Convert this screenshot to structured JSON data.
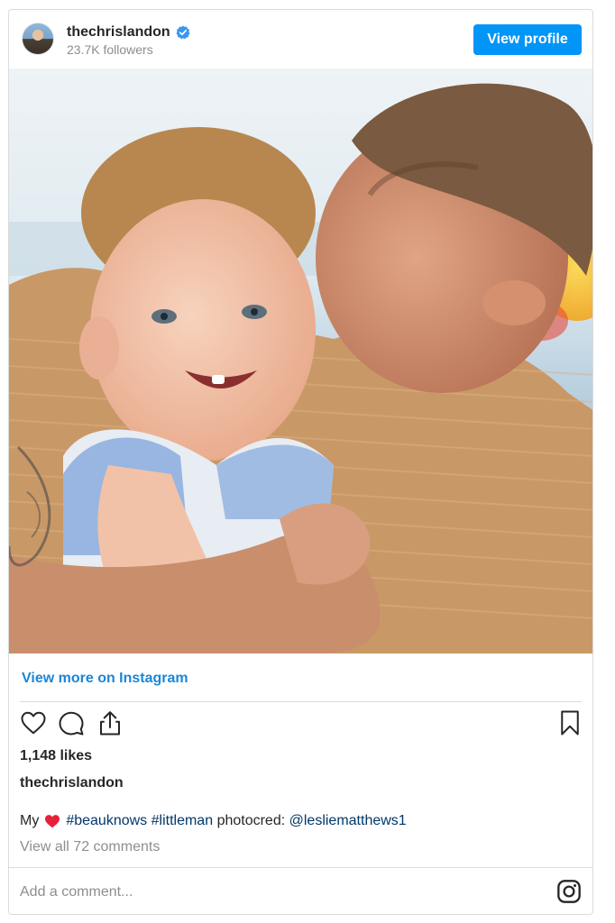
{
  "header": {
    "username": "thechrislandon",
    "followers": "23.7K followers",
    "view_profile_label": "View profile",
    "verified_icon": "verified-badge-icon"
  },
  "post": {
    "view_more_label": "View more on Instagram",
    "likes": "1,148 likes",
    "caption_user": "thechrislandon",
    "caption": {
      "prefix": "My",
      "emoji": "red-heart",
      "hashtag1": "#beauknows",
      "hashtag2": "#littleman",
      "text_middle": "photocred:",
      "mention": "@lesliematthews1"
    },
    "view_all_comments": "View all 72 comments",
    "add_comment_placeholder": "Add a comment..."
  },
  "icons": [
    "heart-icon",
    "comment-icon",
    "share-icon",
    "bookmark-icon",
    "instagram-icon"
  ],
  "colors": {
    "accent": "#0095f6",
    "link": "#1b86d6",
    "hashtag": "#00376b",
    "muted": "#8e8e8e",
    "heart_emoji": "#e8213a"
  }
}
